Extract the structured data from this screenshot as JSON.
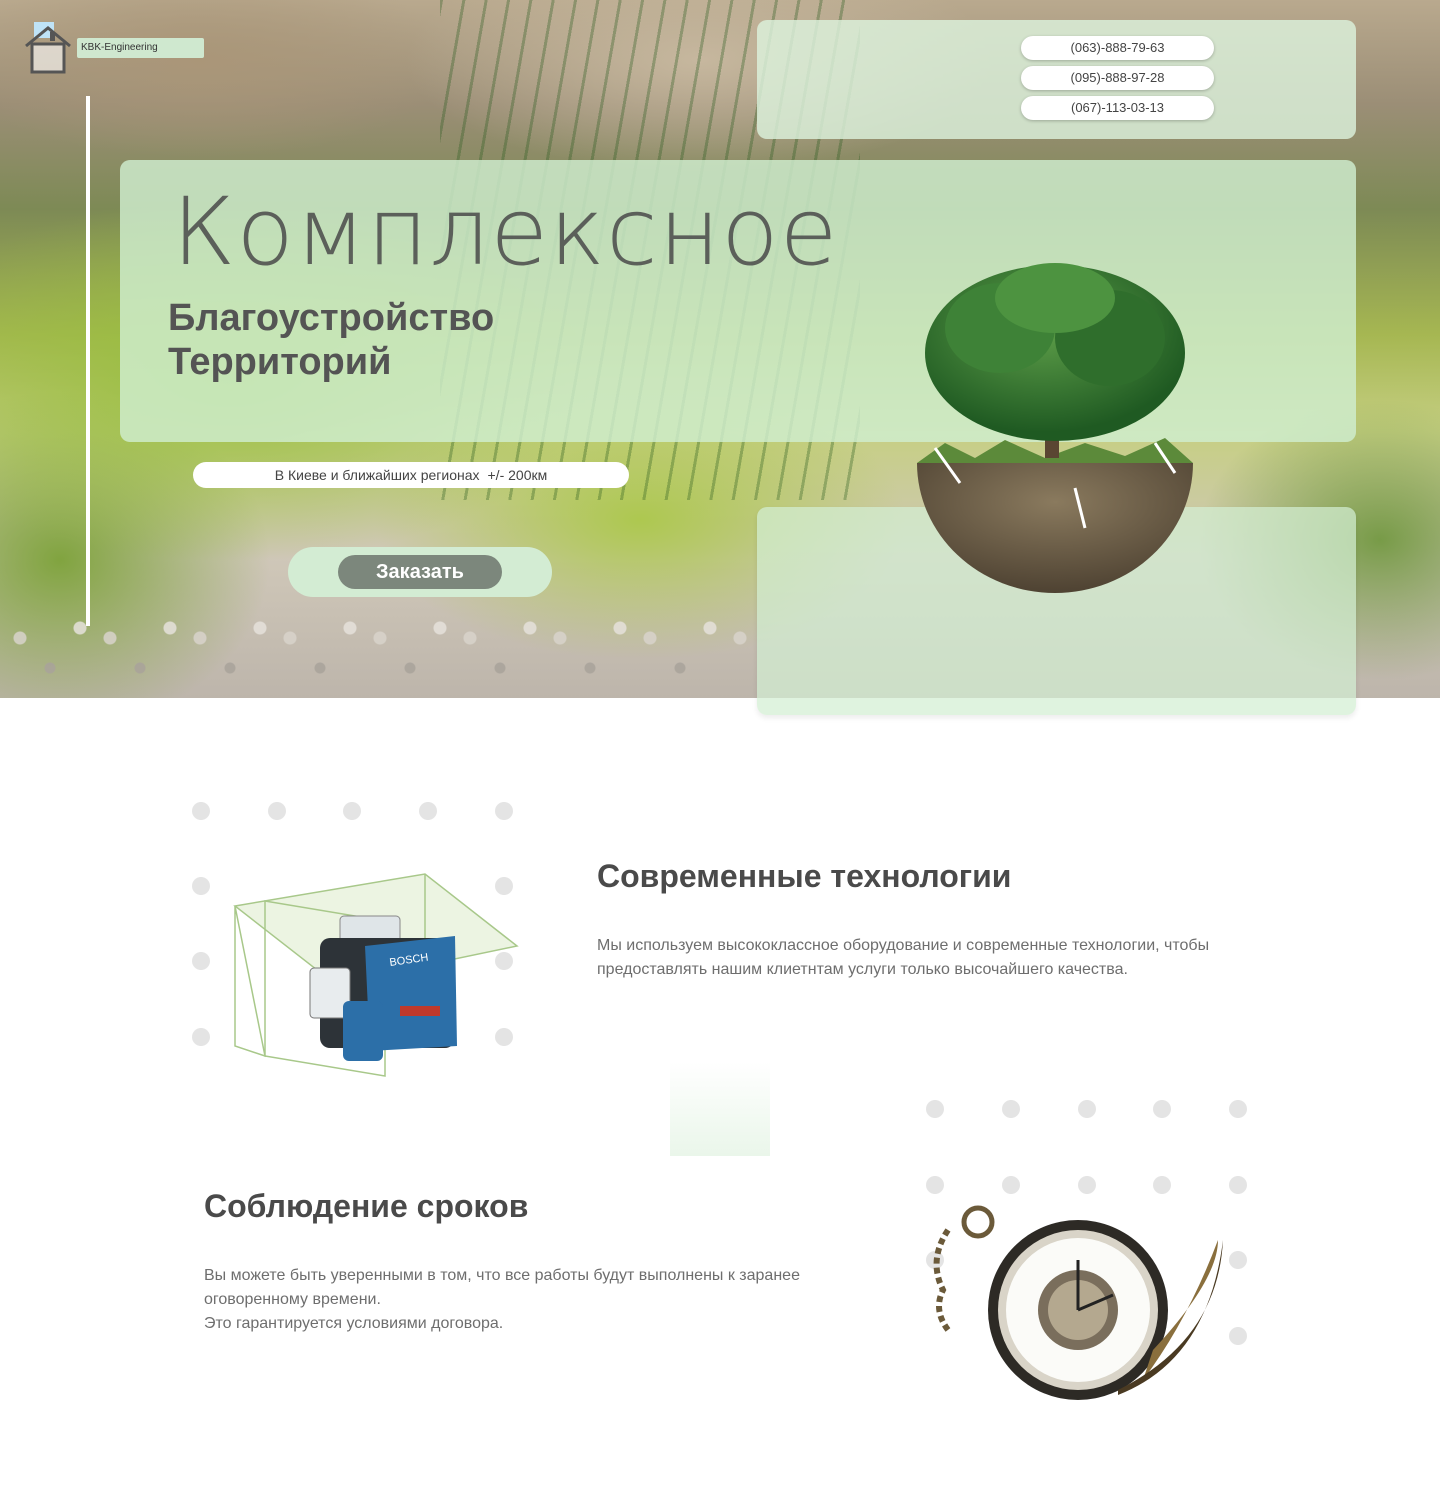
{
  "brand": {
    "name": "KBK-Engineering"
  },
  "header": {
    "phones": [
      "(063)-888-79-63",
      "(095)-888-97-28",
      "(067)-113-03-13"
    ]
  },
  "hero": {
    "headline_light": "Комплексное",
    "headline_bold_1": "Благоустройство",
    "headline_bold_2": "Территорий",
    "region": "В Киеве и ближайших регионах",
    "region_distance": "+/- 200км",
    "order_button": "Заказать"
  },
  "features": [
    {
      "title": "Современные технологии",
      "text": "Мы используем высококлассное оборудование и современные технологии, чтобы предоставлять нашим клиетнтам услуги только высочайшего качества.",
      "icon": "laser-level-icon"
    },
    {
      "title": "Соблюдение сроков",
      "text_line_1": "Вы можете быть уверенными в том, что все работы будут выполнены к заранее оговоренному времени.",
      "text_line_2": "Это гарантируется условиями договора.",
      "icon": "pocket-watch-icon"
    }
  ],
  "colors": {
    "panel_green": "#d0eed0",
    "button_gray": "#7c877c",
    "text_dark": "#4a4a4a"
  }
}
